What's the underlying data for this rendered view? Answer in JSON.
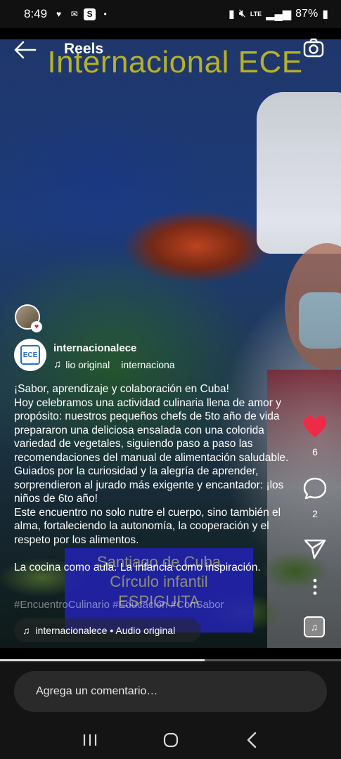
{
  "status_bar": {
    "time": "8:49",
    "battery": "87%",
    "network": "LTE"
  },
  "video": {
    "overlay_title": "Internacional ECE",
    "banner_lines": [
      "Santiago de Cuba",
      "Círculo infantil",
      "ESPIGUITA"
    ]
  },
  "nav": {
    "title": "Reels"
  },
  "post": {
    "username": "internacionalece",
    "audio_label": "lio original",
    "audio_user": "internaciona",
    "caption": "¡Sabor, aprendizaje y colaboración en Cuba!\nHoy celebramos una actividad culinaria llena de amor y propósito: nuestros pequeños chefs de 5to año de vida prepararon una deliciosa ensalada con una colorida variedad de vegetales, siguiendo paso a paso las recomendaciones del manual de alimentación saludable.\nGuiados por la curiosidad y la alegría de aprender, sorprendieron al jurado más exigente y encantador: ¡los niños de 6to año!\nEste encuentro no solo nutre el cuerpo, sino también el alma, fortaleciendo la autonomía, la cooperación y el respeto por los alimentos.\n\nLa cocina como aula. La infancia como inspiración.",
    "hashtags": "#EncuentroCulinario #Educación #ConSabor",
    "audio_pill": "internacionalece • Audio original",
    "logo_text": "ECE"
  },
  "actions": {
    "likes": "6",
    "comments": "2",
    "like_color": "#e0245e"
  },
  "progress": {
    "fraction": 0.6
  },
  "comment": {
    "placeholder": "Agrega un comentario…"
  },
  "icons": {
    "back": "arrow-left-icon",
    "camera": "camera-icon",
    "like": "heart-icon",
    "comment": "comment-bubble-icon",
    "share": "send-icon",
    "more": "more-vertical-icon",
    "music": "music-note-icon"
  }
}
